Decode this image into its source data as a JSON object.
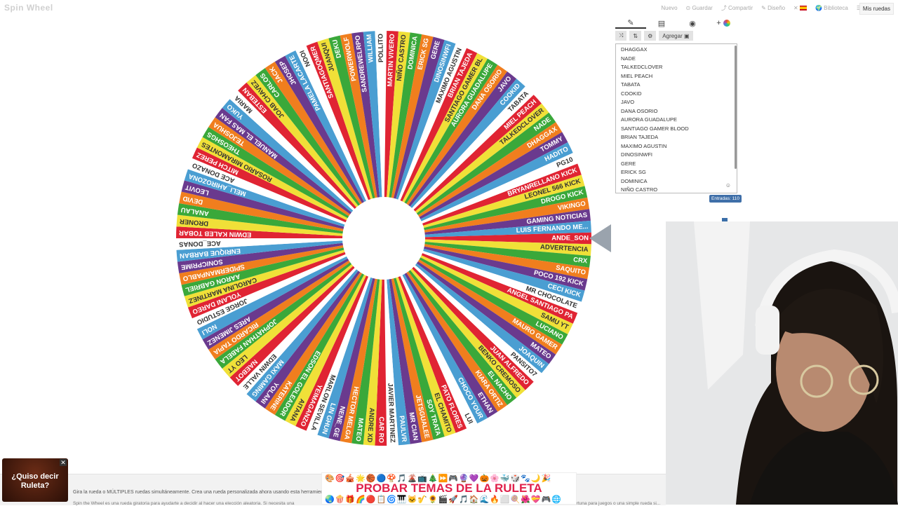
{
  "app": {
    "brand": "Spin Wheel"
  },
  "topnav": {
    "items": [
      "Nuevo",
      "Guardar",
      "Compartir",
      "Diseño",
      "Biblioteca"
    ],
    "my_wheels": "Mis ruedas"
  },
  "panel": {
    "add_label": "Agregar",
    "count_label": "Entradas: 110"
  },
  "entries": [
    "DHAGGAX",
    "NADE",
    "TALKEDCLOVER",
    "MIEL PEACH",
    "TABATA",
    "COOKID",
    "JAVO",
    "DANA OSORIO",
    "AURORA GUADALUPE",
    "SANTIAGO GAMER BLOOD",
    "BRIAN TAJEDA",
    "MAXIMO AGUSTIN",
    "DINOSINWFI",
    "GERE",
    "ERICK SG",
    "DOMINICA",
    "NIÑO CASTRO"
  ],
  "wheel": {
    "colors": [
      "#e02433",
      "#f0e038",
      "#3aa83a",
      "#f07e1e",
      "#6a3a8e",
      "#4a9ed2",
      "#ffffff"
    ],
    "labels": [
      "ANDE_SON",
      "ADVERTENCIA",
      "CRX",
      "SAQUITO",
      "POCO 192 KICK",
      "CECI KICK",
      "MR CHOCOLATE",
      "ANGEL SANTIAGO PA",
      "SAMU YT",
      "LUCIANO",
      "MAURO GAMER",
      "MATEO",
      "JOAQUIN",
      "PANSITO7",
      "JUAN ALFREDO",
      "BENKO CREMOSO",
      "EL NACHO",
      "KIARA ORTIZ",
      "ETHAN",
      "CHOCO YOUR",
      "LUI",
      "PATO FLORES",
      "EL CHAMITO",
      "SOY TRATA",
      "JETSGUALEE",
      "MR CIAN",
      "PAULVR",
      "JAVIER MARTINEZ",
      "CAR RO",
      "ANDRE XD",
      "MATEO",
      "HECTOR MELGA",
      "NENE_GE",
      "LIN GHUN",
      "MARLON SEVILLA",
      "YEIMAGANZO",
      "AITANA",
      "EDSON EL GOLEADOR",
      "KATERINE",
      "YOLANI",
      "MAXI GAMING",
      "EDWIN VALLE",
      "NAEBOT",
      "LEO YT",
      "JOPHATHAN FABELA",
      "RICARDO TAPIA",
      "ARES JIMENEZ",
      "NOLI",
      "JORGE ESTUDIO",
      "YOLANI DAREO",
      "CAROLINA MARTINEZ",
      "AARON GABRIEL",
      "SPIDERMANPABLO",
      "SONICPRIME",
      "ENRIQUE BARBAN",
      "ACE_DONAS",
      "EDWIN KALEB TOBAR",
      "DRONER",
      "ANALAU",
      "DEVID",
      "LEOVIT",
      "MELI_AHIROZONA",
      "ACE DONAZO",
      "MITCH PEREZ",
      "ROSARIO MIRAMONTES",
      "THEOSHGS",
      "TEJOSHUA",
      "MANUEL EL MAS FAN",
      "YUKO",
      "MARIA",
      "ESTEBAN",
      "JOAB CHAVEZ",
      "CARLOS",
      "JACK",
      "JHOSEP",
      "PAMELA LACARTE",
      "NOOI",
      "SANTIAGOQMER",
      "JUANQUI",
      "DEKU",
      "POWERWOLF",
      "SANDREWELRPO",
      "WILLIAM",
      "POLLITO",
      "MARTIN VIVERO",
      "NIÑO CASTRO",
      "DOMINICA",
      "ERICK SG",
      "GERE",
      "DINOSINWFI",
      "MAXIMO AGUSTIN",
      "BRIAN TAJEDA",
      "SANTIAGO GAMER BL",
      "AURORA GUADALUPE",
      "DANA OSORIO",
      "JAVO",
      "COOKID",
      "TABATA",
      "MIEL PEACH",
      "TALKEDCLOVER",
      "NADE",
      "DHAGGAX",
      "TOMMY",
      "HADITO",
      "PG10",
      "BRYANRELLANO KICK",
      "LEONEL 566 KICK",
      "DROGO KICK",
      "VIKINGO",
      "GAMING NOTICIAS",
      "LUIS FERNANDO ME..."
    ]
  },
  "popup": {
    "text": "¿Quiso decir Ruleta?"
  },
  "promo": {
    "title": "PROBAR TEMAS DE LA RULETA",
    "emojis_top": "🎨🎯🎪🌟🏀🔵🍄🎵🌋📺🎄⏩🎮🔮💜🎃🌸🐳🎲🐾🌙🎉",
    "emojis_bottom": "🌏🍿🎁🌈🔴📋🌀🎹🐱🎷🌻🎬🚀🎵🏠🌊🔥⬜🍭🌺💝🎮🌐"
  },
  "footer": {
    "line1": "Gira la rueda o MÚLTIPLES ruedas simultáneamente. Crea una rueda personalizada ahora usando esta herramienta",
    "line2": "Spin the Wheel es una rueda giratoria para ayudarte a decidir al hacer una elección aleatoria. Si necesita una",
    "line3": "ortuna para juegos o una simple rueda si..."
  }
}
